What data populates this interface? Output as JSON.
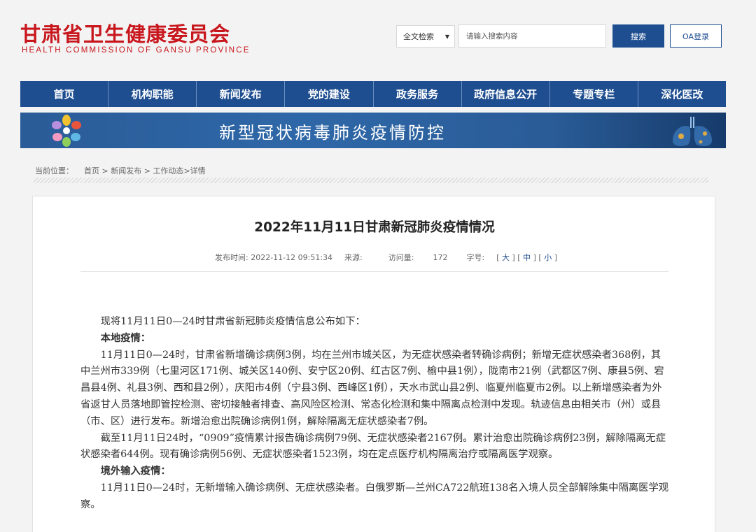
{
  "header": {
    "logo_cn": "甘肃省卫生健康委员会",
    "logo_en": "HEALTH COMMISSION OF GANSU PROVINCE",
    "search_scope": "全文检索",
    "search_placeholder": "请输入搜索内容",
    "search_button": "搜索",
    "oa_button": "OA登录"
  },
  "nav": {
    "items": [
      "首页",
      "机构职能",
      "新闻发布",
      "党的建设",
      "政务服务",
      "政府信息公开",
      "专题专栏",
      "深化医改"
    ]
  },
  "banner": {
    "title": "新型冠状病毒肺炎疫情防控"
  },
  "breadcrumb": {
    "label": "当前位置：",
    "home": "首页",
    "sep": " > ",
    "news": "新闻发布",
    "work": "工作动态",
    "detail": "详情"
  },
  "article": {
    "title": "2022年11月11日甘肃新冠肺炎疫情情况",
    "publish_label": "发布时间:",
    "publish_time": "2022-11-12 09:51:34",
    "source_label": "来源:",
    "views_label": "访问量:",
    "views": "172",
    "font_label": "字号:",
    "font_large": "大",
    "font_medium": "中",
    "font_small": "小",
    "paragraphs": [
      "现将11月11日0—24时甘肃省新冠肺炎疫情信息公布如下：",
      "本地疫情：",
      "11月11日0—24时，甘肃省新增确诊病例3例，均在兰州市城关区，为无症状感染者转确诊病例；新增无症状感染者368例，其中兰州市339例（七里河区171例、城关区140例、安宁区20例、红古区7例、榆中县1例），陇南市21例（武都区7例、康县5例、宕昌县4例、礼县3例、西和县2例），庆阳市4例（宁县3例、西峰区1例），天水市武山县2例、临夏州临夏市2例。以上新增感染者为外省返甘人员落地即管控检测、密切接触者排查、高风险区检测、常态化检测和集中隔离点检测中发现。轨迹信息由相关市（州）或县（市、区）进行发布。新增治愈出院确诊病例1例，解除隔离无症状感染者7例。",
      "截至11月11日24时，“0909”疫情累计报告确诊病例79例、无症状感染者2167例。累计治愈出院确诊病例23例，解除隔离无症状感染者644例。现有确诊病例56例、无症状感染者1523例，均在定点医疗机构隔离治疗或隔离医学观察。",
      "境外输入疫情：",
      "11月11日0—24时，无新增输入确诊病例、无症状感染者。白俄罗斯—兰州CA722航班138名入境人员全部解除集中隔离医学观察。"
    ]
  },
  "colors": {
    "brand_red": "#c8161d",
    "nav_blue": "#1e4e90"
  }
}
